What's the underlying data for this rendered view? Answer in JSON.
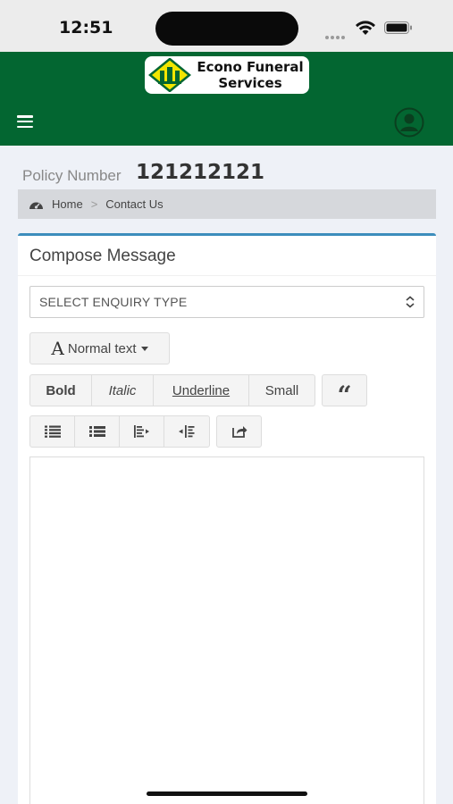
{
  "status_bar": {
    "time": "12:51"
  },
  "header": {
    "logo_line1": "Econo Funeral",
    "logo_line2": "Services",
    "icons": {
      "menu": "hamburger-menu-icon",
      "user": "user-avatar-icon"
    },
    "color": "#036631"
  },
  "policy": {
    "label": "Policy Number",
    "number": "121212121"
  },
  "breadcrumb": {
    "home": "Home",
    "separator": ">",
    "current": "Contact Us"
  },
  "compose": {
    "title": "Compose Message",
    "enquiry_select": {
      "value": "SELECT ENQUIRY TYPE"
    },
    "toolbar": {
      "font_glyph": "A",
      "font_label": "Normal text",
      "bold": "Bold",
      "italic": "Italic",
      "underline": "Underline",
      "small": "Small",
      "quote_glyph": "“"
    },
    "accent_color": "#3c8dbc"
  }
}
